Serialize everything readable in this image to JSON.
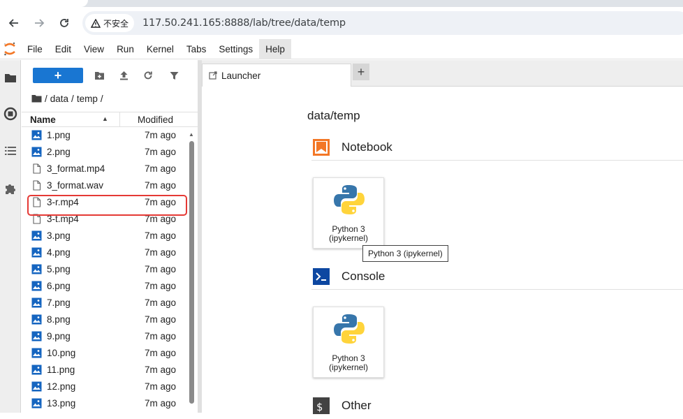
{
  "browser": {
    "security_label": "不安全",
    "url": "117.50.241.165:8888/lab/tree/data/temp"
  },
  "menubar": {
    "items": [
      "File",
      "Edit",
      "View",
      "Run",
      "Kernel",
      "Tabs",
      "Settings",
      "Help"
    ]
  },
  "filebrowser": {
    "new_button_label": "+",
    "breadcrumb": [
      "/",
      "data",
      "/",
      "temp",
      "/"
    ],
    "columns": {
      "name": "Name",
      "modified": "Modified"
    },
    "files": [
      {
        "name": "1.png",
        "type": "image",
        "modified": "7m ago"
      },
      {
        "name": "2.png",
        "type": "image",
        "modified": "7m ago"
      },
      {
        "name": "3_format.mp4",
        "type": "file",
        "modified": "7m ago"
      },
      {
        "name": "3_format.wav",
        "type": "file",
        "modified": "7m ago"
      },
      {
        "name": "3-r.mp4",
        "type": "file",
        "modified": "7m ago"
      },
      {
        "name": "3-t.mp4",
        "type": "file",
        "modified": "7m ago"
      },
      {
        "name": "3.png",
        "type": "image",
        "modified": "7m ago"
      },
      {
        "name": "4.png",
        "type": "image",
        "modified": "7m ago"
      },
      {
        "name": "5.png",
        "type": "image",
        "modified": "7m ago"
      },
      {
        "name": "6.png",
        "type": "image",
        "modified": "7m ago"
      },
      {
        "name": "7.png",
        "type": "image",
        "modified": "7m ago"
      },
      {
        "name": "8.png",
        "type": "image",
        "modified": "7m ago"
      },
      {
        "name": "9.png",
        "type": "image",
        "modified": "7m ago"
      },
      {
        "name": "10.png",
        "type": "image",
        "modified": "7m ago"
      },
      {
        "name": "11.png",
        "type": "image",
        "modified": "7m ago"
      },
      {
        "name": "12.png",
        "type": "image",
        "modified": "7m ago"
      },
      {
        "name": "13.png",
        "type": "image",
        "modified": "7m ago"
      }
    ]
  },
  "main": {
    "tab_label": "Launcher",
    "add_tab_label": "+",
    "path": "data/temp",
    "sections": {
      "notebook": {
        "title": "Notebook",
        "card_line1": "Python 3",
        "card_line2": "(ipykernel)"
      },
      "console": {
        "title": "Console",
        "card_line1": "Python 3",
        "card_line2": "(ipykernel)"
      },
      "other": {
        "title": "Other"
      }
    },
    "tooltip": "Python 3 (ipykernel)"
  },
  "colors": {
    "jupyter_orange": "#f37726",
    "brand_blue": "#1976d2",
    "highlight_red": "#e53935",
    "python_blue": "#3776ab",
    "python_yellow": "#ffd43b"
  }
}
